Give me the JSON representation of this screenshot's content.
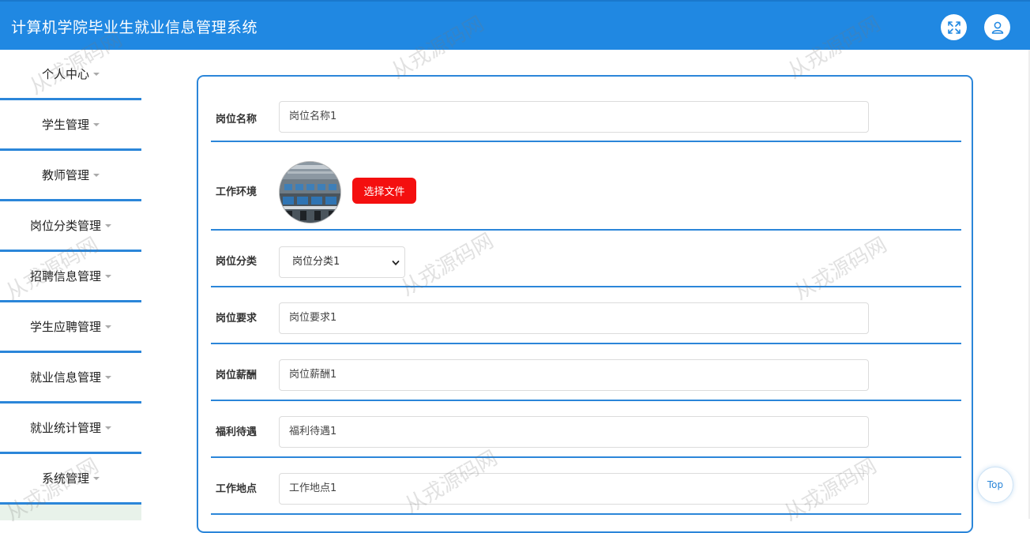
{
  "header": {
    "title": "计算机学院毕业生就业信息管理系统"
  },
  "sidebar": {
    "items": [
      {
        "label": "个人中心"
      },
      {
        "label": "学生管理"
      },
      {
        "label": "教师管理"
      },
      {
        "label": "岗位分类管理"
      },
      {
        "label": "招聘信息管理"
      },
      {
        "label": "学生应聘管理"
      },
      {
        "label": "就业信息管理"
      },
      {
        "label": "就业统计管理"
      },
      {
        "label": "系统管理"
      }
    ]
  },
  "form": {
    "job_name": {
      "label": "岗位名称",
      "value": "岗位名称1"
    },
    "work_env": {
      "label": "工作环境",
      "button": "选择文件"
    },
    "category": {
      "label": "岗位分类",
      "value": "岗位分类1"
    },
    "requirement": {
      "label": "岗位要求",
      "value": "岗位要求1"
    },
    "salary": {
      "label": "岗位薪酬",
      "value": "岗位薪酬1"
    },
    "benefits": {
      "label": "福利待遇",
      "value": "福利待遇1"
    },
    "location": {
      "label": "工作地点",
      "value": "工作地点1"
    }
  },
  "watermark": "从戎源码网",
  "top_button": "Top",
  "colors": {
    "header": "#2088e2",
    "accent": "#2b86d9",
    "file_button": "#f40f0f"
  }
}
